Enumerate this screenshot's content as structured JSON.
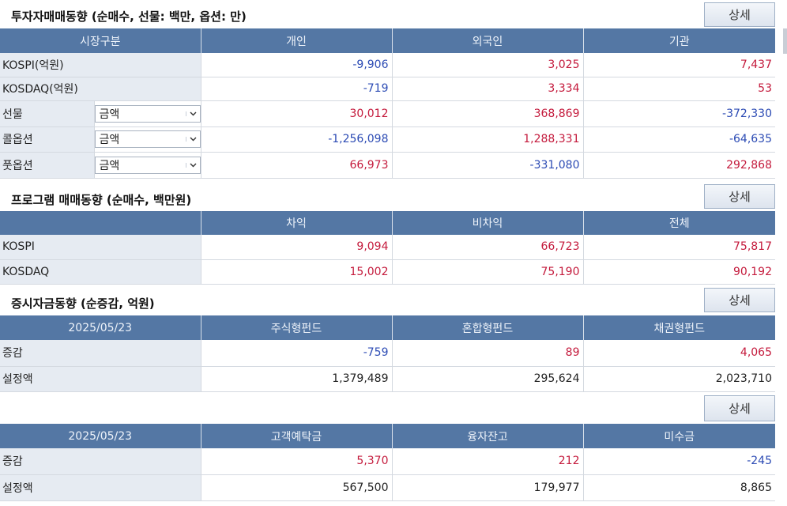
{
  "investor": {
    "title": "투자자매매동향 (순매수, 선물: 백만, 옵션: 만)",
    "detail_label": "상세",
    "headers": [
      "시장구분",
      "개인",
      "외국인",
      "기관"
    ],
    "rows": [
      {
        "label": "KOSPI(억원)",
        "values": [
          "-9,906",
          "3,025",
          "7,437"
        ]
      },
      {
        "label": "KOSDAQ(억원)",
        "values": [
          "-719",
          "3,334",
          "53"
        ]
      },
      {
        "label": "선물",
        "select": "금액",
        "values": [
          "30,012",
          "368,869",
          "-372,330"
        ]
      },
      {
        "label": "콜옵션",
        "select": "금액",
        "values": [
          "-1,256,098",
          "1,288,331",
          "-64,635"
        ]
      },
      {
        "label": "풋옵션",
        "select": "금액",
        "values": [
          "66,973",
          "-331,080",
          "292,868"
        ]
      }
    ]
  },
  "program": {
    "title": "프로그램 매매동향 (순매수, 백만원)",
    "detail_label": "상세",
    "headers": [
      "",
      "차익",
      "비차익",
      "전체"
    ],
    "rows": [
      {
        "label": "KOSPI",
        "values": [
          "9,094",
          "66,723",
          "75,817"
        ]
      },
      {
        "label": "KOSDAQ",
        "values": [
          "15,002",
          "75,190",
          "90,192"
        ]
      }
    ]
  },
  "funds": {
    "title": "증시자금동향 (순증감, 억원)",
    "detail_label": "상세",
    "headers": [
      "2025/05/23",
      "주식형펀드",
      "혼합형펀드",
      "채권형펀드"
    ],
    "rows": [
      {
        "label": "증감",
        "values": [
          "-759",
          "89",
          "4,065"
        ]
      },
      {
        "label": "설정액",
        "values": [
          "1,379,489",
          "295,624",
          "2,023,710"
        ]
      }
    ]
  },
  "deposits": {
    "detail_label": "상세",
    "headers": [
      "2025/05/23",
      "고객예탁금",
      "융자잔고",
      "미수금"
    ],
    "rows": [
      {
        "label": "증감",
        "values": [
          "5,370",
          "212",
          "-245"
        ]
      },
      {
        "label": "설정액",
        "values": [
          "567,500",
          "179,977",
          "8,865"
        ]
      }
    ]
  },
  "colors": {
    "header_bg": "#5477a4",
    "label_bg": "#e6ebf2",
    "positive": "#c41a3c",
    "negative": "#2c4bb4"
  },
  "icons": {
    "select_arrow": "chevron-down-icon"
  }
}
